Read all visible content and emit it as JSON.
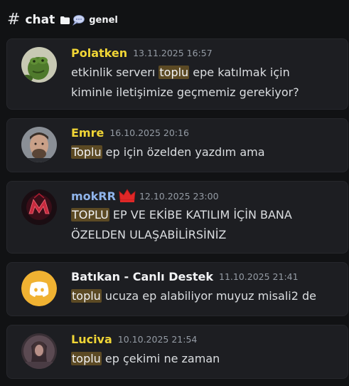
{
  "header": {
    "channel": "chat",
    "thread": "genel"
  },
  "messages": [
    {
      "author": "Polatken",
      "author_color": "#f0d536",
      "time": "13.11.2025 16:57",
      "lines": [
        [
          "etkinlik serverı ",
          "toplu",
          " epe katılmak için"
        ],
        [
          "kiminle iletişimize geçmemiz gerekiyor?",
          "",
          ""
        ]
      ]
    },
    {
      "author": "Emre",
      "author_color": "#f0d536",
      "time": "16.10.2025 20:16",
      "lines": [
        [
          "",
          "Toplu",
          " ep için özelden yazdım ama"
        ]
      ]
    },
    {
      "author": "mokRR",
      "author_color": "#8fb4ea",
      "time": "12.10.2025 23:00",
      "lines": [
        [
          "",
          "TOPLU",
          " EP VE EKİBE KATILIM İÇİN BANA"
        ],
        [
          "ÖZELDEN ULAŞABİLİRSİNİZ",
          "",
          ""
        ]
      ]
    },
    {
      "author": "Batıkan - Canlı Destek",
      "author_color": "#f2f3f5",
      "time": "11.10.2025 21:41",
      "lines": [
        [
          "",
          "toplu",
          " ucuza ep alabiliyor muyuz misali2 de"
        ]
      ]
    },
    {
      "author": "Luciva",
      "author_color": "#f0d536",
      "time": "10.10.2025 21:54",
      "lines": [
        [
          "",
          "toplu",
          " ep çekimi ne zaman"
        ]
      ]
    }
  ]
}
